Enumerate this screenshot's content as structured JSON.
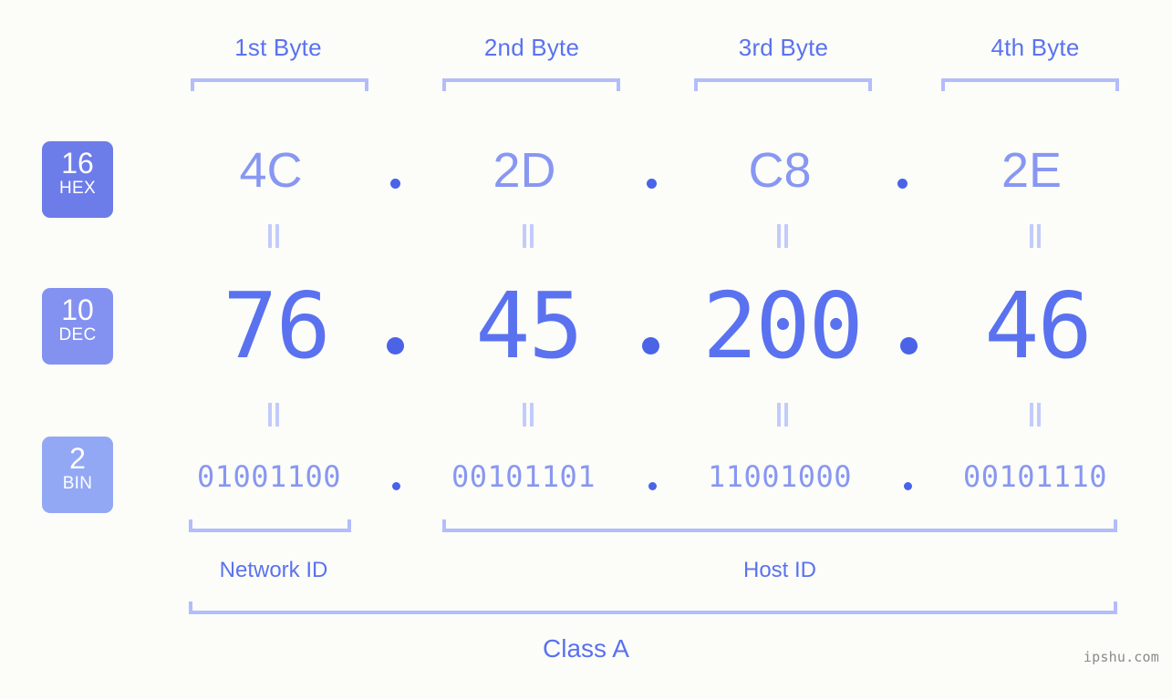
{
  "background_color": "#fcfdf9",
  "accent_color": "#5a72ef",
  "light_accent_color": "#8897f2",
  "bracket_color": "#b3bdfb",
  "byte_headers": [
    {
      "label": "1st Byte"
    },
    {
      "label": "2nd Byte"
    },
    {
      "label": "3rd Byte"
    },
    {
      "label": "4th Byte"
    }
  ],
  "rows": [
    {
      "badge_number": "16",
      "badge_name": "HEX",
      "badge_color": "#6c7ce8",
      "values": [
        "4C",
        "2D",
        "C8",
        "2E"
      ]
    },
    {
      "badge_number": "10",
      "badge_name": "DEC",
      "badge_color": "#8392f0",
      "values": [
        "76",
        "45",
        "200",
        "46"
      ]
    },
    {
      "badge_number": "2",
      "badge_name": "BIN",
      "badge_color": "#93a8f4",
      "values": [
        "01001100",
        "00101101",
        "11001000",
        "00101110"
      ]
    }
  ],
  "separator": ".",
  "equality_mark": "=",
  "segments": {
    "network_id": "Network ID",
    "host_id": "Host ID"
  },
  "class_label": "Class A",
  "watermark": "ipshu.com"
}
